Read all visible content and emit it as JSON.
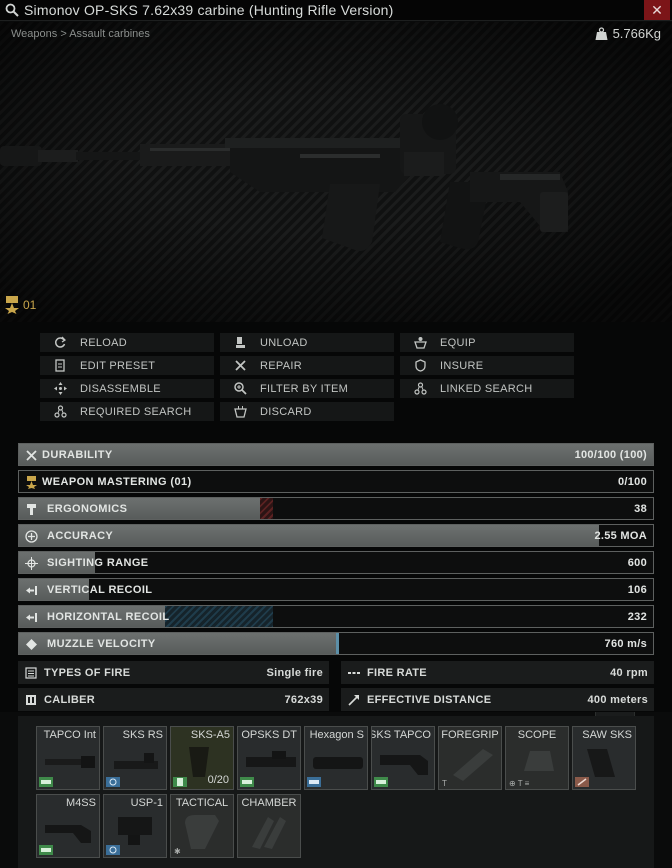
{
  "window": {
    "title": "Simonov OP-SKS 7.62x39 carbine (Hunting Rifle Version)",
    "close_glyph": "✕"
  },
  "preview": {
    "breadcrumb": "Weapons > Assault carbines",
    "weight": "5.766Kg",
    "mastery_level": "01"
  },
  "actions": [
    {
      "label": "RELOAD",
      "icon": "reload-icon"
    },
    {
      "label": "UNLOAD",
      "icon": "unload-icon"
    },
    {
      "label": "EQUIP",
      "icon": "equip-icon"
    },
    {
      "label": "EDIT PRESET",
      "icon": "edit-preset-icon"
    },
    {
      "label": "REPAIR",
      "icon": "repair-icon"
    },
    {
      "label": "INSURE",
      "icon": "insure-icon"
    },
    {
      "label": "DISASSEMBLE",
      "icon": "disassemble-icon"
    },
    {
      "label": "FILTER BY ITEM",
      "icon": "filter-icon"
    },
    {
      "label": "LINKED SEARCH",
      "icon": "linked-search-icon"
    },
    {
      "label": "REQUIRED SEARCH",
      "icon": "required-search-icon"
    },
    {
      "label": "DISCARD",
      "icon": "discard-icon"
    }
  ],
  "stats": [
    {
      "label": "DURABILITY",
      "value": "100/100 (100)",
      "fill": 1.0,
      "icon": "durability-icon"
    },
    {
      "label": "WEAPON MASTERING (01)",
      "value": "0/100",
      "fill": 0.0,
      "icon": "mastering-icon"
    },
    {
      "label": "ERGONOMICS",
      "value": "38",
      "fill": 0.38,
      "icon": "ergonomics-icon"
    },
    {
      "label": "ACCURACY",
      "value": "2.55 MOA",
      "fill": 0.915,
      "icon": "accuracy-icon"
    },
    {
      "label": "SIGHTING RANGE",
      "value": "600",
      "fill": 0.12,
      "icon": "sighting-range-icon"
    },
    {
      "label": "VERTICAL RECOIL",
      "value": "106",
      "fill": 0.11,
      "icon": "vertical-recoil-icon"
    },
    {
      "label": "HORIZONTAL RECOIL",
      "value": "232",
      "fill": 0.23,
      "icon": "horizontal-recoil-icon"
    },
    {
      "label": "MUZZLE VELOCITY",
      "value": "760 m/s",
      "fill": 0.5,
      "icon": "muzzle-velocity-icon"
    }
  ],
  "info": [
    {
      "label": "TYPES OF FIRE",
      "value": "Single fire",
      "icon": "fire-type-icon"
    },
    {
      "label": "FIRE RATE",
      "value": "40 rpm",
      "icon": "fire-rate-icon"
    },
    {
      "label": "CALIBER",
      "value": "762x39",
      "icon": "caliber-icon"
    },
    {
      "label": "EFFECTIVE DISTANCE",
      "value": "400 meters",
      "icon": "distance-icon"
    }
  ],
  "mods": [
    {
      "name": "TAPCO Int",
      "empty": false,
      "count": ""
    },
    {
      "name": "SKS RS",
      "empty": false,
      "count": ""
    },
    {
      "name": "SKS-A5",
      "empty": false,
      "count": "0/20"
    },
    {
      "name": "OPSKS DT",
      "empty": false,
      "count": ""
    },
    {
      "name": "Hexagon S",
      "empty": false,
      "count": ""
    },
    {
      "name": "SKS TAPCO",
      "empty": false,
      "count": ""
    },
    {
      "name": "FOREGRIP",
      "empty": true,
      "count": ""
    },
    {
      "name": "SCOPE",
      "empty": true,
      "count": ""
    },
    {
      "name": "SAW SKS",
      "empty": false,
      "count": ""
    },
    {
      "name": "M4SS",
      "empty": false,
      "count": ""
    },
    {
      "name": "USP-1",
      "empty": false,
      "count": ""
    },
    {
      "name": "TACTICAL",
      "empty": true,
      "count": ""
    },
    {
      "name": "CHAMBER",
      "empty": true,
      "count": ""
    }
  ],
  "colors": {
    "mastery_gold": "#c9a64b",
    "close_red": "#7c1518",
    "stat_fill": "#656968",
    "negative": "#5a2121",
    "positive": "#1f3c4b"
  }
}
